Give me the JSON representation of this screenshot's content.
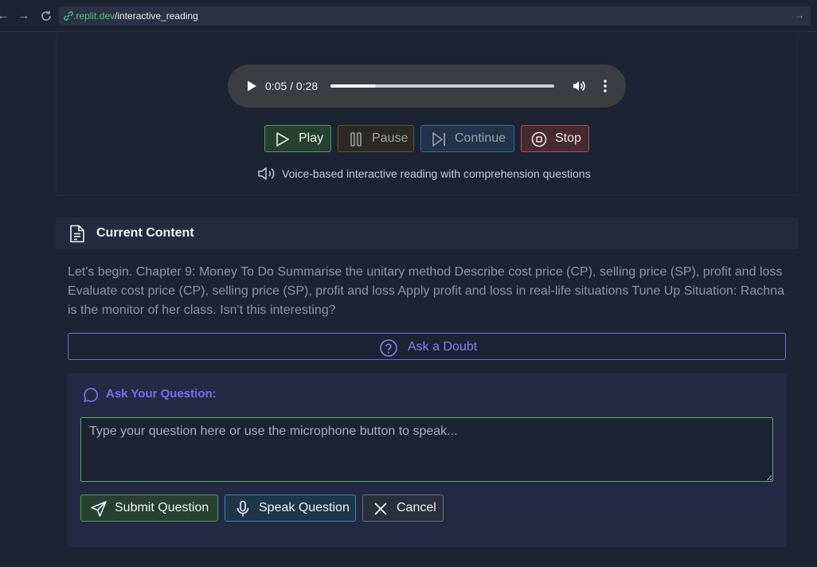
{
  "browser": {
    "url_host": ".replit.dev",
    "url_path": "/interactive_reading"
  },
  "audio": {
    "time_display": "0:05 / 0:28",
    "progress": 0.2
  },
  "controls": {
    "play_label": "Play",
    "pause_label": "Pause",
    "continue_label": "Continue",
    "stop_label": "Stop"
  },
  "voice_note": "Voice-based interactive reading with comprehension questions",
  "content": {
    "title": "Current Content",
    "text": "Let's begin. Chapter 9: Money To Do Summarise the unitary method Describe cost price (CP), selling price (SP), profit and loss Evaluate cost price (CP), selling price (SP), profit and loss Apply profit and loss in real-life situations Tune Up Situation: Rachna is the monitor of her class. Isn't this interesting?"
  },
  "doubt": {
    "button_label": "Ask a Doubt",
    "heading": "Ask Your Question:",
    "placeholder": "Type your question here or use the microphone button to speak...",
    "submit_label": "Submit Question",
    "speak_label": "Speak Question",
    "cancel_label": "Cancel"
  },
  "colors": {
    "background": "#1c2333",
    "accent_purple": "#7d6cf0",
    "success_green": "#4b9c5e",
    "info_blue": "#2f86b8",
    "danger_red": "#b34a55"
  }
}
